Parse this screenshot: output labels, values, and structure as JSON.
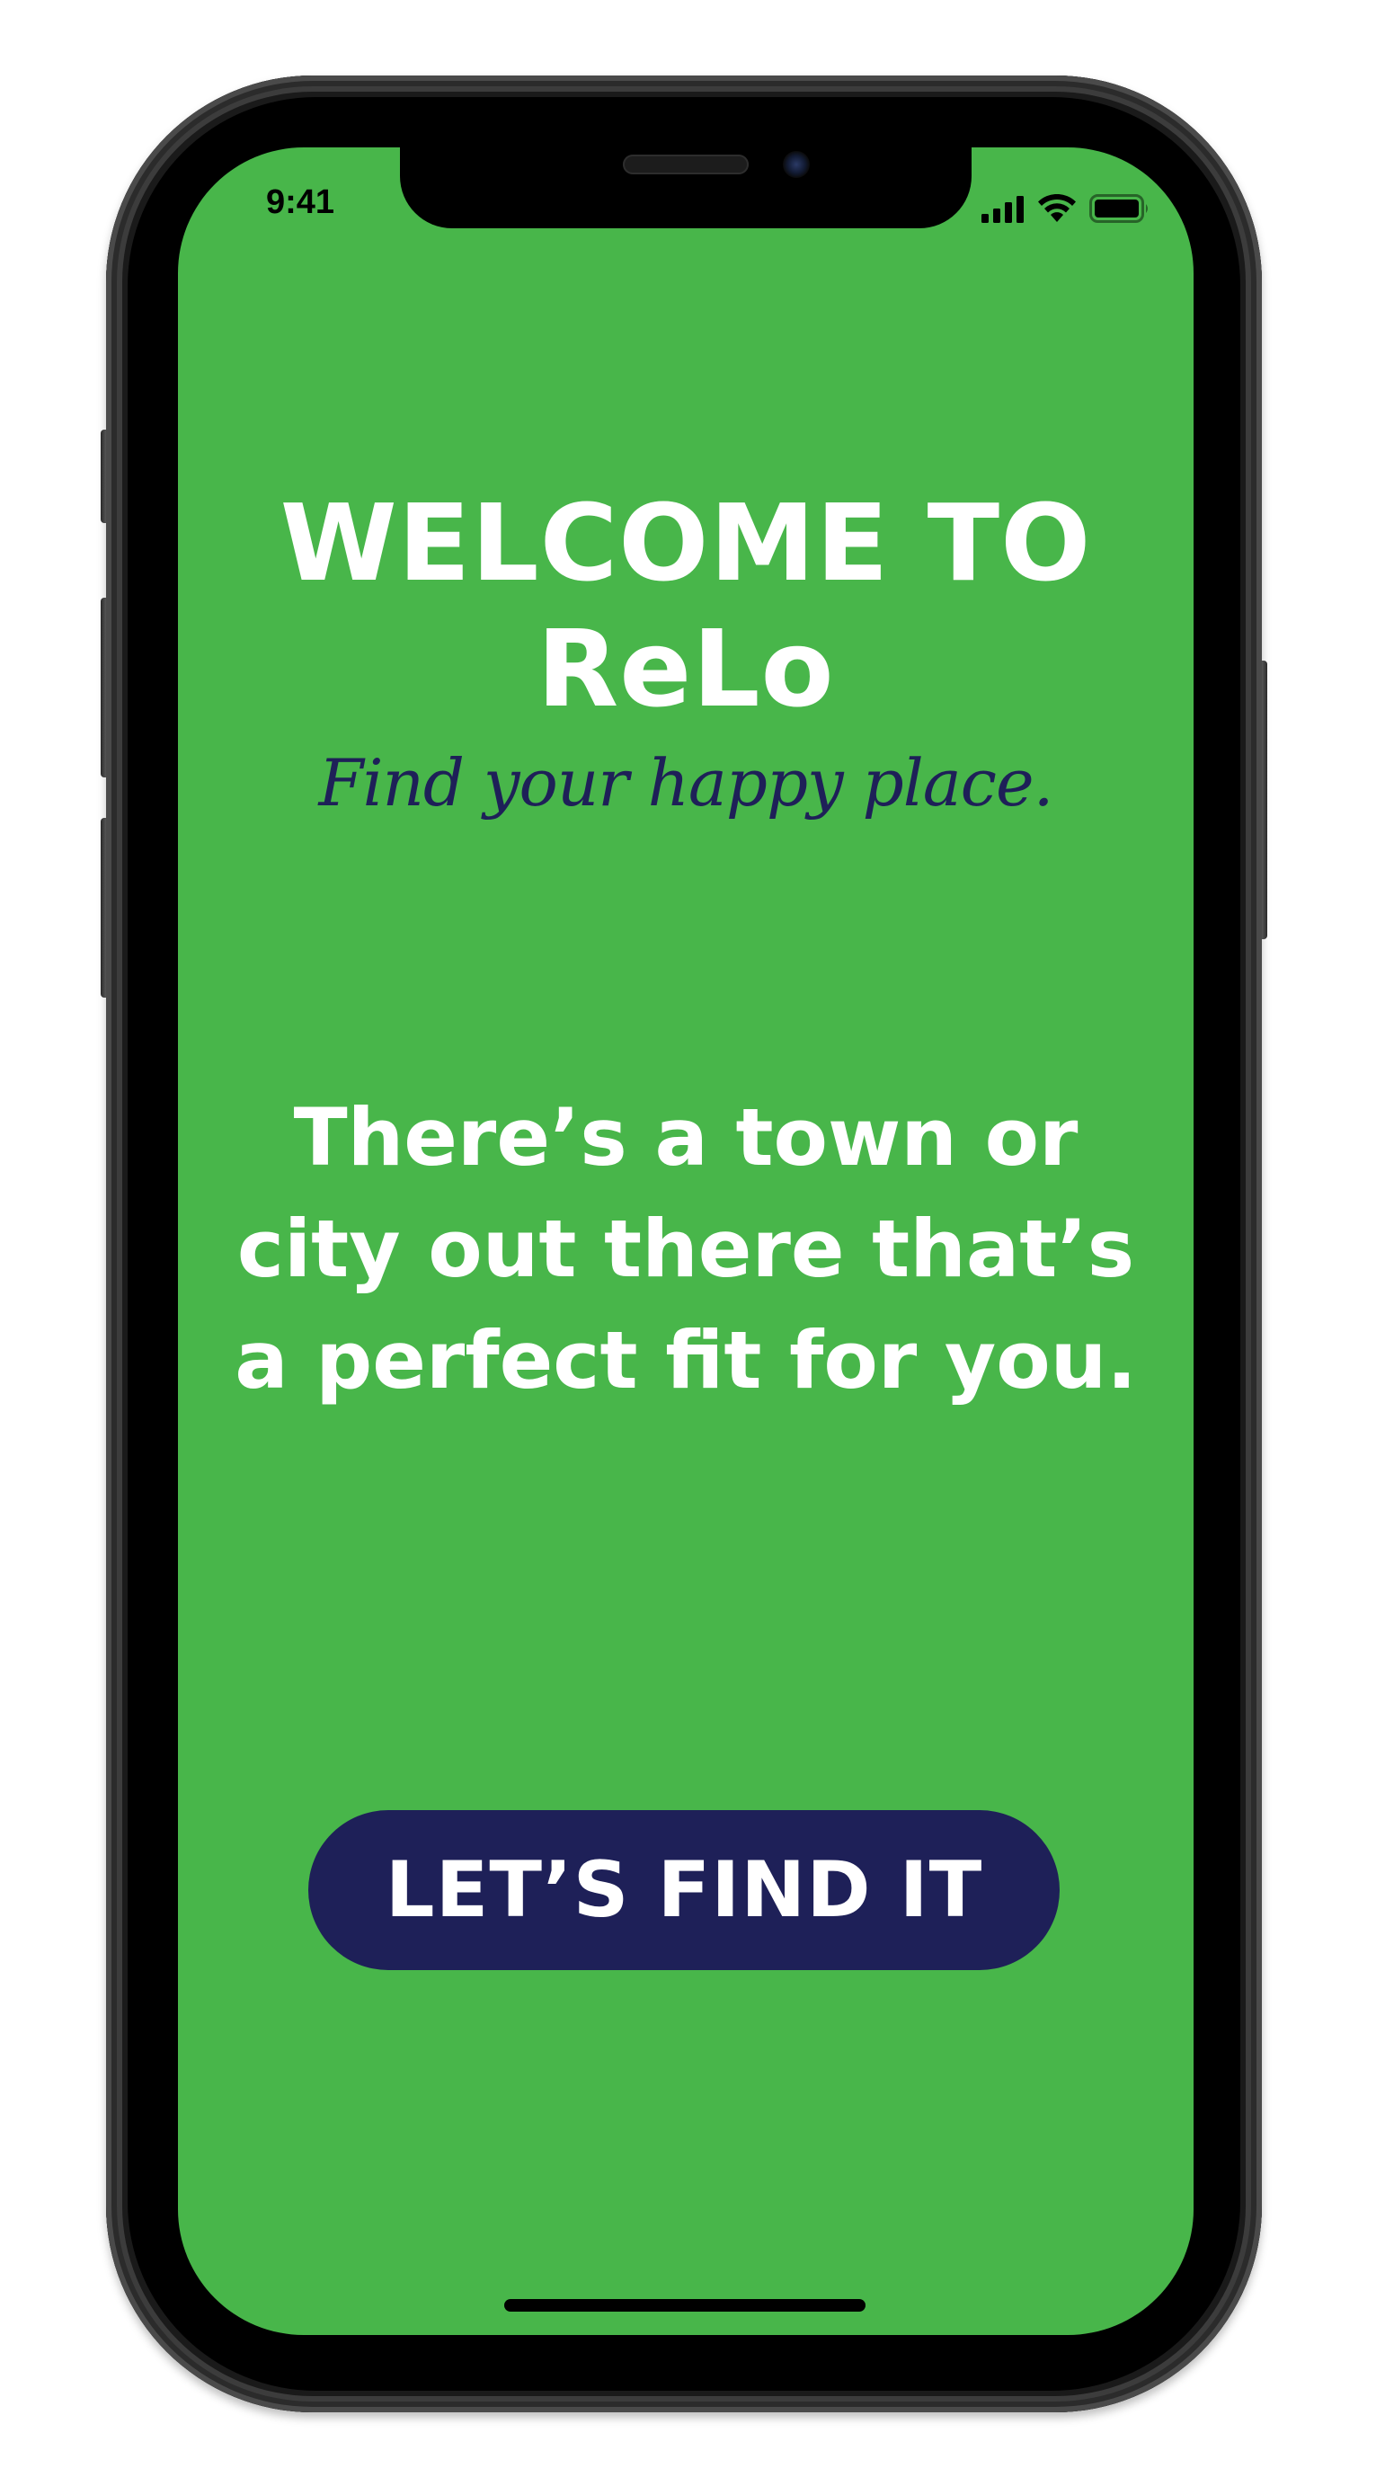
{
  "status_bar": {
    "time": "9:41",
    "icons": [
      "signal-icon",
      "wifi-icon",
      "battery-icon"
    ]
  },
  "welcome": {
    "title_line1": "WELCOME TO",
    "title_line2": "ReLo",
    "tagline": "Find your happy place."
  },
  "body": {
    "line1": "There’s a town or",
    "line2": "city out there that’s",
    "line3": "a perfect fit for you."
  },
  "cta": {
    "label": "LET’S FIND IT"
  },
  "colors": {
    "screen_background": "#48b64a",
    "accent_navy": "#1e2058",
    "text_white": "#ffffff"
  }
}
